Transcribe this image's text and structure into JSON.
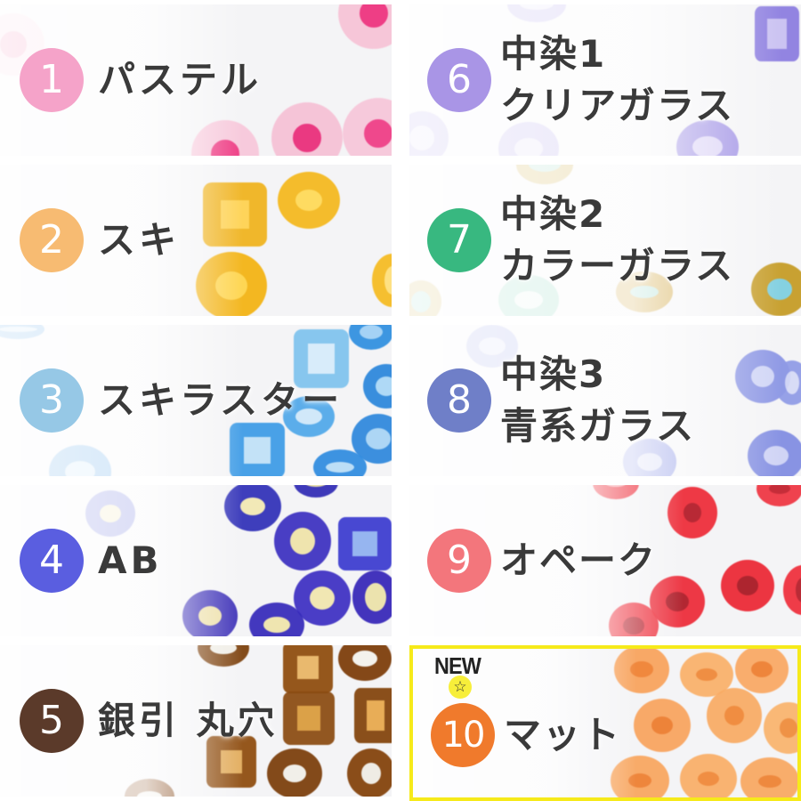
{
  "badge": {
    "new_text": "NEW",
    "star_icon": "☆"
  },
  "colors": {
    "highlight_border": "#f6ea1a",
    "label_text": "#3a3a3a"
  },
  "items": [
    {
      "number": "1",
      "lines": [
        "パステル"
      ],
      "circle_color": "#f5a3c9"
    },
    {
      "number": "2",
      "lines": [
        "スキ"
      ],
      "circle_color": "#f7bb72"
    },
    {
      "number": "3",
      "lines": [
        "スキラスター"
      ],
      "circle_color": "#96c8e6"
    },
    {
      "number": "4",
      "lines": [
        "AB"
      ],
      "circle_color": "#5a5ee0"
    },
    {
      "number": "5",
      "lines": [
        "銀引 丸穴"
      ],
      "circle_color": "#5b3a2a"
    },
    {
      "number": "6",
      "lines": [
        "中染1",
        "クリアガラス"
      ],
      "circle_color": "#a995e6"
    },
    {
      "number": "7",
      "lines": [
        "中染2",
        "カラーガラス"
      ],
      "circle_color": "#38b880"
    },
    {
      "number": "8",
      "lines": [
        "中染3",
        "青系ガラス"
      ],
      "circle_color": "#6f7fc8"
    },
    {
      "number": "9",
      "lines": [
        "オペーク"
      ],
      "circle_color": "#f3767c"
    },
    {
      "number": "10",
      "lines": [
        "マット"
      ],
      "circle_color": "#f07a2c",
      "is_new": true
    }
  ]
}
